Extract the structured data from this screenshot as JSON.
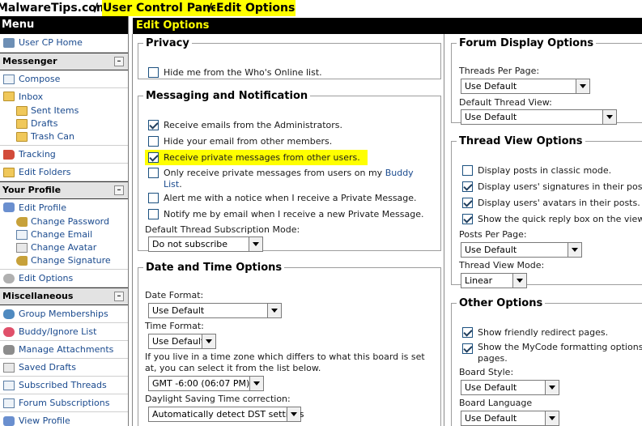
{
  "breadcrumb": {
    "site": "MalwareTips.com",
    "sep1": "/",
    "ucp": "User Control Panel",
    "sep2": "/",
    "current": "Edit Options"
  },
  "sidebar": {
    "menu_title": "Menu",
    "usercp_home": "User CP Home",
    "messenger": {
      "title": "Messenger",
      "compose": "Compose",
      "inbox": "Inbox",
      "sent": "Sent Items",
      "drafts": "Drafts",
      "trash": "Trash Can",
      "tracking": "Tracking",
      "edit_folders": "Edit Folders"
    },
    "profile": {
      "title": "Your Profile",
      "edit_profile": "Edit Profile",
      "change_password": "Change Password",
      "change_email": "Change Email",
      "change_avatar": "Change Avatar",
      "change_signature": "Change Signature",
      "edit_options": "Edit Options"
    },
    "misc": {
      "title": "Miscellaneous",
      "group_memberships": "Group Memberships",
      "buddy_list": "Buddy/Ignore List",
      "attachments": "Manage Attachments",
      "saved_drafts": "Saved Drafts",
      "subscribed_threads": "Subscribed Threads",
      "forum_subscriptions": "Forum Subscriptions",
      "view_profile": "View Profile"
    },
    "collapse_symbol": "–"
  },
  "main": {
    "title": "Edit Options",
    "privacy": {
      "legend": "Privacy",
      "invisible": {
        "label": "Hide me from the Who's Online list.",
        "checked": false
      }
    },
    "messaging": {
      "legend": "Messaging and Notification",
      "admin_emails": {
        "label": "Receive emails from the Administrators.",
        "checked": true
      },
      "hide_email": {
        "label": "Hide your email from other members.",
        "checked": false
      },
      "receive_pms": {
        "label": "Receive private messages from other users.",
        "checked": true
      },
      "buddy_only_pre": {
        "label": "Only receive private messages from users on my",
        "checked": false
      },
      "buddy_link": "Buddy",
      "buddy_list_word": "List",
      "buddy_period": ".",
      "pm_alert": {
        "label": "Alert me with a notice when I receive a Private Message.",
        "checked": false
      },
      "pm_email": {
        "label": "Notify me by email when I receive a new Private Message.",
        "checked": false
      },
      "subscription_mode_label": "Default Thread Subscription Mode:",
      "subscription_mode_value": "Do not subscribe"
    },
    "datetime": {
      "legend": "Date and Time Options",
      "date_format_label": "Date Format:",
      "date_format_value": "Use Default",
      "time_format_label": "Time Format:",
      "time_format_value": "Use Default",
      "timezone_note_1": "If you live in a time zone which differs to what this board is set",
      "timezone_note_2": "at, you can select it from the list below.",
      "timezone_value": "GMT -6:00 (06:07 PM)",
      "dst_label": "Daylight Saving Time correction:",
      "dst_value": "Automatically detect DST settings"
    },
    "forum_display": {
      "legend": "Forum Display Options",
      "threads_per_page_label": "Threads Per Page:",
      "threads_per_page_value": "Use Default",
      "default_view_label": "Default Thread View:",
      "default_view_value": "Use Default"
    },
    "thread_view": {
      "legend": "Thread View Options",
      "classic": {
        "label": "Display posts in classic mode.",
        "checked": false
      },
      "signatures": {
        "label": "Display users' signatures in their pos",
        "checked": true
      },
      "avatars": {
        "label": "Display users' avatars in their posts.",
        "checked": true
      },
      "quick_reply": {
        "label": "Show the quick reply box on the view",
        "checked": true
      },
      "posts_per_page_label": "Posts Per Page:",
      "posts_per_page_value": "Use Default",
      "thread_view_mode_label": "Thread View Mode:",
      "thread_view_mode_value": "Linear"
    },
    "other": {
      "legend": "Other Options",
      "redirect": {
        "label": "Show friendly redirect pages.",
        "checked": true
      },
      "mycode_1": {
        "label": "Show the MyCode formatting options",
        "checked": true
      },
      "mycode_2": "pages.",
      "board_style_label": "Board Style:",
      "board_style_value": "Use Default",
      "board_language_label": "Board Language",
      "board_language_value": "Use Default"
    }
  }
}
